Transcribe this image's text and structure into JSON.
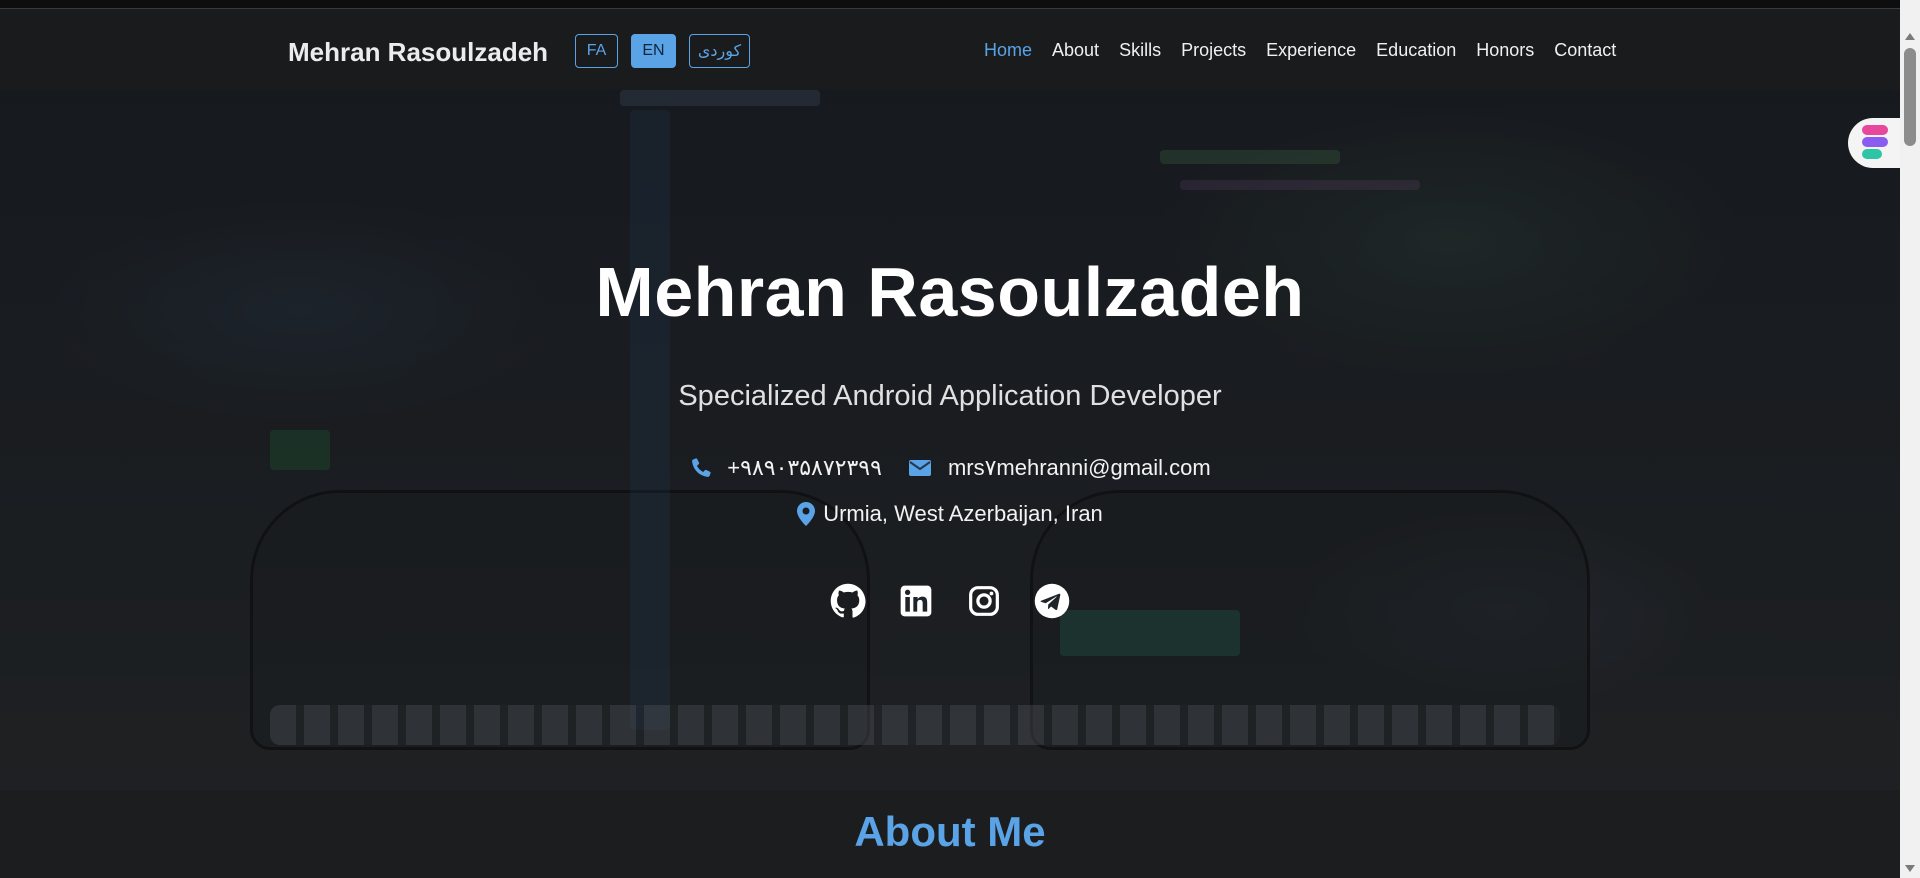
{
  "navbar": {
    "brand": "Mehran Rasoulzadeh",
    "languages": [
      {
        "label": "FA",
        "active": false
      },
      {
        "label": "EN",
        "active": true
      },
      {
        "label": "کوردی",
        "active": false
      }
    ],
    "links": [
      {
        "label": "Home",
        "active": true
      },
      {
        "label": "About",
        "active": false
      },
      {
        "label": "Skills",
        "active": false
      },
      {
        "label": "Projects",
        "active": false
      },
      {
        "label": "Experience",
        "active": false
      },
      {
        "label": "Education",
        "active": false
      },
      {
        "label": "Honors",
        "active": false
      },
      {
        "label": "Contact",
        "active": false
      }
    ]
  },
  "hero": {
    "title": "Mehran Rasoulzadeh",
    "subtitle": "Specialized Android Application Developer",
    "phone": "+۹۸۹۰۳۵۸۷۲۳۹۹",
    "email": "mrs۷mehranni@gmail.com",
    "location": "Urmia, West Azerbaijan, Iran",
    "social": [
      "github-icon",
      "linkedin-icon",
      "instagram-icon",
      "telegram-icon"
    ]
  },
  "about": {
    "title": "About Me"
  },
  "colors": {
    "accent": "#5aa3e6",
    "background": "#1b1c1e",
    "text": "#f0f0f0"
  }
}
